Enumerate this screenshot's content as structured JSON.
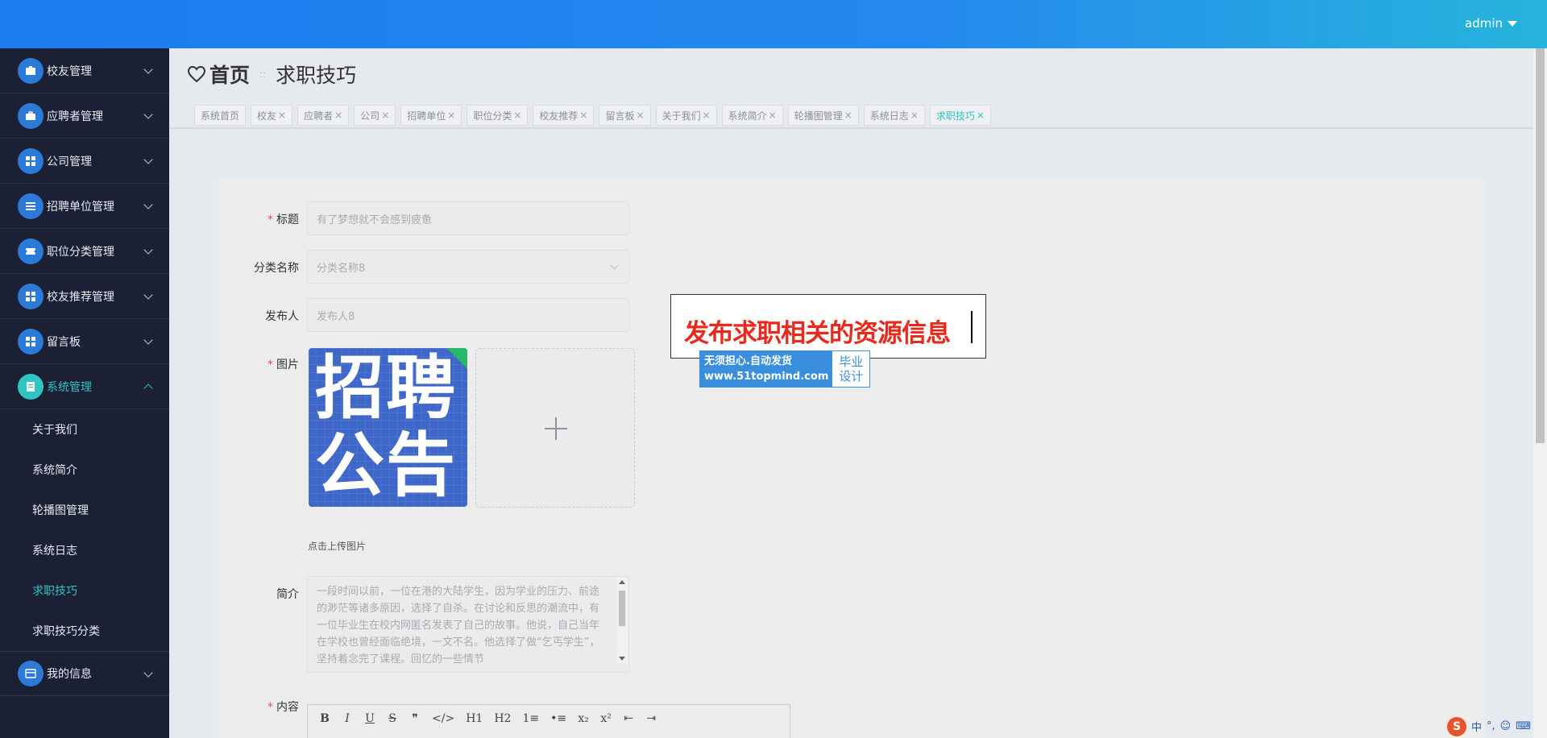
{
  "header": {
    "user": "admin"
  },
  "sidebar": {
    "items": [
      {
        "label": "校友管理",
        "icon": "id-card-icon"
      },
      {
        "label": "应聘者管理",
        "icon": "briefcase-icon"
      },
      {
        "label": "公司管理",
        "icon": "grid-icon"
      },
      {
        "label": "招聘单位管理",
        "icon": "list-icon"
      },
      {
        "label": "职位分类管理",
        "icon": "ticket-icon"
      },
      {
        "label": "校友推荐管理",
        "icon": "grid-icon"
      },
      {
        "label": "留言板",
        "icon": "grid-icon"
      },
      {
        "label": "系统管理",
        "icon": "document-icon"
      },
      {
        "label": "我的信息",
        "icon": "card-icon"
      }
    ],
    "system_sub": [
      "关于我们",
      "系统简介",
      "轮播图管理",
      "系统日志",
      "求职技巧",
      "求职技巧分类"
    ]
  },
  "breadcrumb": {
    "home": "首页",
    "sep": "::",
    "current": "求职技巧"
  },
  "tags": [
    "系统首页",
    "校友",
    "应聘者",
    "公司",
    "招聘单位",
    "职位分类",
    "校友推荐",
    "留言板",
    "关于我们",
    "系统简介",
    "轮播图管理",
    "系统日志",
    "求职技巧"
  ],
  "tag_close": "×",
  "form": {
    "title_label": "标题",
    "title_placeholder": "有了梦想就不会感到疲惫",
    "category_label": "分类名称",
    "category_placeholder": "分类名称8",
    "publisher_label": "发布人",
    "publisher_placeholder": "发布人8",
    "image_label": "图片",
    "image_text_1": "招聘",
    "image_text_2": "公告",
    "upload_hint": "点击上传图片",
    "summary_label": "简介",
    "summary_text": "一段时间以前，一位在港的大陆学生，因为学业的压力、前途的渺茫等诸多原因，选择了自杀。在讨论和反思的潮流中，有一位毕业生在校内网匿名发表了自己的故事。他说，自己当年在学校也曾经面临绝境，一文不名。他选择了做“乞丐学生”，坚持着念完了课程。回忆的一些情节",
    "content_label": "内容",
    "required_mark": "*"
  },
  "editor_toolbar": [
    "B",
    "I",
    "U",
    "S",
    "❞",
    "</>",
    "H1",
    "H2",
    "1≡",
    "•≡",
    "x₂",
    "x²",
    "⇤",
    "⇥"
  ],
  "overlay": {
    "banner_text": "发布求职相关的资源信息",
    "wm_line1": "无须担心.自动发货",
    "wm_line2": "www.51topmind.com",
    "wm_right1": "毕业",
    "wm_right2": "设计"
  },
  "ime": {
    "logo": "S",
    "mode": "中",
    "punct": "°,",
    "emoji": "☺",
    "keyboard": "⌨"
  },
  "colors": {
    "accent": "#2fc3c3",
    "header_start": "#1b7cf0",
    "header_end": "#27b4dc",
    "sidebar_bg": "#1b2034",
    "banner_red": "#e82a1c"
  }
}
